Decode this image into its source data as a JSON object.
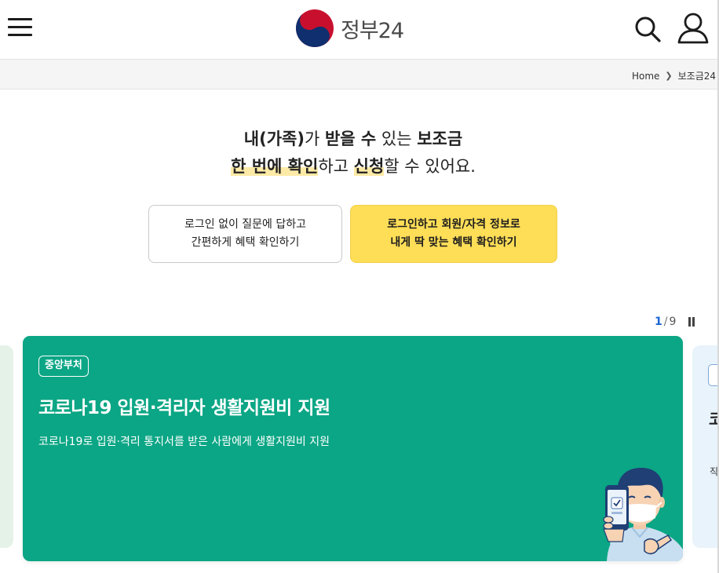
{
  "header": {
    "menu_icon": "hamburger-menu-icon",
    "logo_text": "정부24",
    "search_icon": "search-icon",
    "user_icon": "user-icon"
  },
  "breadcrumb": {
    "items": [
      "Home",
      "보조금24"
    ]
  },
  "intro": {
    "line1": [
      {
        "text": "내(가족)",
        "style": "bold"
      },
      {
        "text": "가 ",
        "style": "normal"
      },
      {
        "text": "받을 수",
        "style": "bold"
      },
      {
        "text": " 있는 ",
        "style": "normal"
      },
      {
        "text": "보조금",
        "style": "bold"
      }
    ],
    "line2": [
      {
        "text": "한 번에 확인",
        "style": "highlight"
      },
      {
        "text": "하고 ",
        "style": "normal"
      },
      {
        "text": "신청",
        "style": "highlight"
      },
      {
        "text": "할 수 있어요.",
        "style": "normal"
      }
    ]
  },
  "cta": {
    "guest": {
      "line1": "로그인 없이 질문에 답하고",
      "line2": "간편하게 혜택 확인하기"
    },
    "login": {
      "line1": "로그인하고 회원/자격 정보로",
      "line2": "내게 딱 맞는 혜택 확인하기"
    }
  },
  "pager": {
    "current": "1",
    "separator": "/",
    "total": "9",
    "pause_icon": "pause-icon"
  },
  "slide": {
    "badge": "중앙부처",
    "title": "코로나19 입원·격리자 생활지원비 지원",
    "description": "코로나19로 입원·격리 통지서를 받은 사람에게 생활지원비 지원",
    "illustration": "masked-person-with-phone-illustration",
    "background_color": "#0ba685"
  },
  "next_slide_peek": {
    "title": "코",
    "desc": "직"
  },
  "colors": {
    "accent_yellow": "#ffde57",
    "brand_blue": "#1a66d2",
    "highlight": "#fdeaa6"
  }
}
